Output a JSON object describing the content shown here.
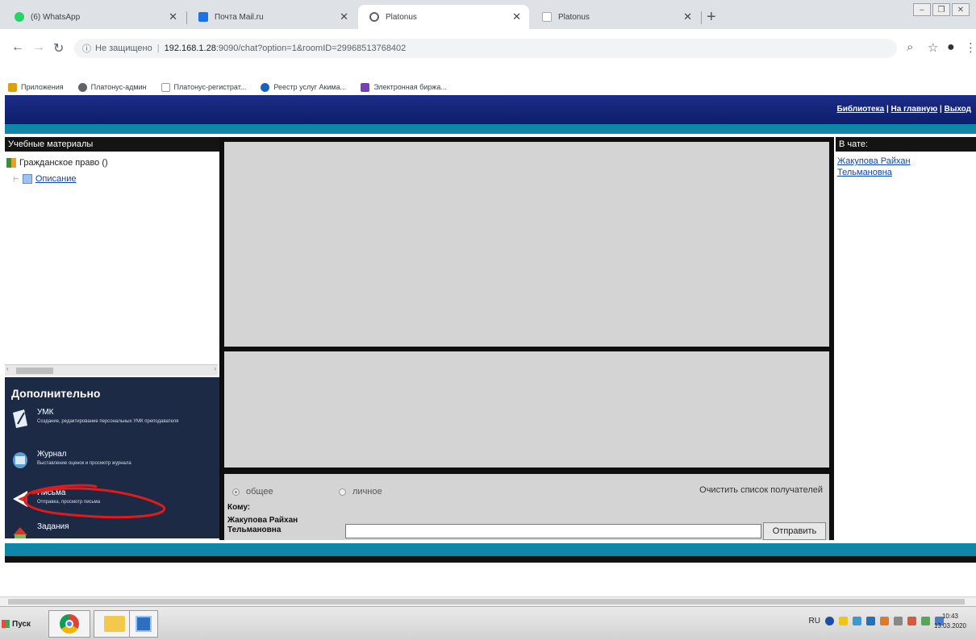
{
  "browser": {
    "tabs": [
      {
        "title": "(6) WhatsApp",
        "favicon_color": "#25d366",
        "active": false
      },
      {
        "title": "Почта Mail.ru",
        "favicon_color": "#1a73e8",
        "active": false
      },
      {
        "title": "Platonus",
        "favicon_color": "#5f6368",
        "active": true
      },
      {
        "title": "Platonus",
        "favicon_color": "#c8c8c8",
        "active": false
      }
    ],
    "security_label": "Не защищено",
    "url_host": "192.168.1.28",
    "url_rest": ":9090/chat?option=1&roomID=29968513768402",
    "bookmarks": [
      {
        "label": "Приложения",
        "color": "#e0a000"
      },
      {
        "label": "Платонус-админ",
        "color": "#5f6368"
      },
      {
        "label": "Платонус-регистрат...",
        "color": "#9e9e9e"
      },
      {
        "label": "Реестр услуг Акима...",
        "color": "#1565c0"
      },
      {
        "label": "Электронная биржа...",
        "color": "#7b3fb5"
      }
    ]
  },
  "site": {
    "header_links": [
      "Библиотека",
      "На главную",
      "Выход"
    ],
    "left_panel_title": "Учебные материалы",
    "tree": {
      "root": "Гражданское право ()",
      "child": "Описание"
    },
    "extra_title": "Дополнительно",
    "extra_items": [
      {
        "title": "УМК",
        "desc": "Создание, редактирование персональных УМК преподавателя",
        "icon_color": "#e8eef8"
      },
      {
        "title": "Журнал",
        "desc": "Выставление оценок и просмотр журнала",
        "icon_color": "#5aa0d8"
      },
      {
        "title": "Письма",
        "desc": "Отправка, просмотр письма",
        "icon_color": "#ffffff"
      },
      {
        "title": "Задания",
        "desc": "",
        "icon_color": "#d0342c"
      }
    ],
    "chat": {
      "radio_general": "общее",
      "radio_private": "личное",
      "clear_label": "Очистить список получателей",
      "to_label": "Кому:",
      "recipient_lines": [
        "Жакупова Райхан",
        "Тельмановна"
      ],
      "message_value": "",
      "send_label": "Отправить"
    },
    "right_panel_title": "В чате:",
    "chat_users": [
      "Жакупова Райхан",
      "Тельмановна"
    ]
  },
  "taskbar": {
    "start_label": "Пуск",
    "lang": "RU",
    "time": "10:43",
    "date": "13.03.2020"
  }
}
